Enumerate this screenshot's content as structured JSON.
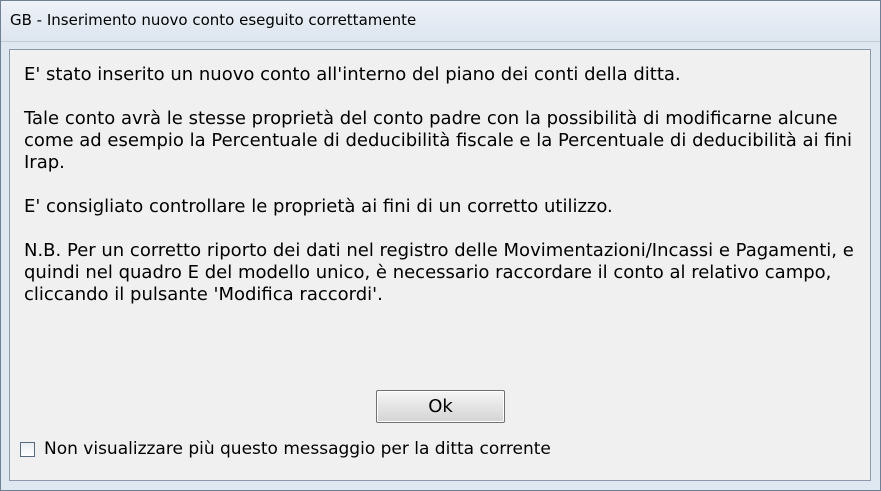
{
  "window": {
    "title": "GB - Inserimento nuovo conto eseguito correttamente"
  },
  "message": {
    "paragraphs": [
      "E' stato inserito un nuovo conto all'interno del piano dei conti della ditta.",
      "Tale conto avrà le stesse proprietà del conto padre con la possibilità di modificarne alcune come ad esempio la Percentuale di deducibilità fiscale e la Percentuale di deducibilità ai fini Irap.",
      "E' consigliato controllare le proprietà ai fini di un corretto utilizzo.",
      "N.B. Per un corretto riporto dei dati nel registro delle Movimentazioni/Incassi e Pagamenti, e quindi nel quadro E del modello unico, è necessario raccordare il conto al relativo campo, cliccando il pulsante 'Modifica raccordi'."
    ]
  },
  "buttons": {
    "ok_label": "Ok"
  },
  "checkbox": {
    "label": "Non visualizzare più questo messaggio per la ditta corrente",
    "checked": false
  }
}
